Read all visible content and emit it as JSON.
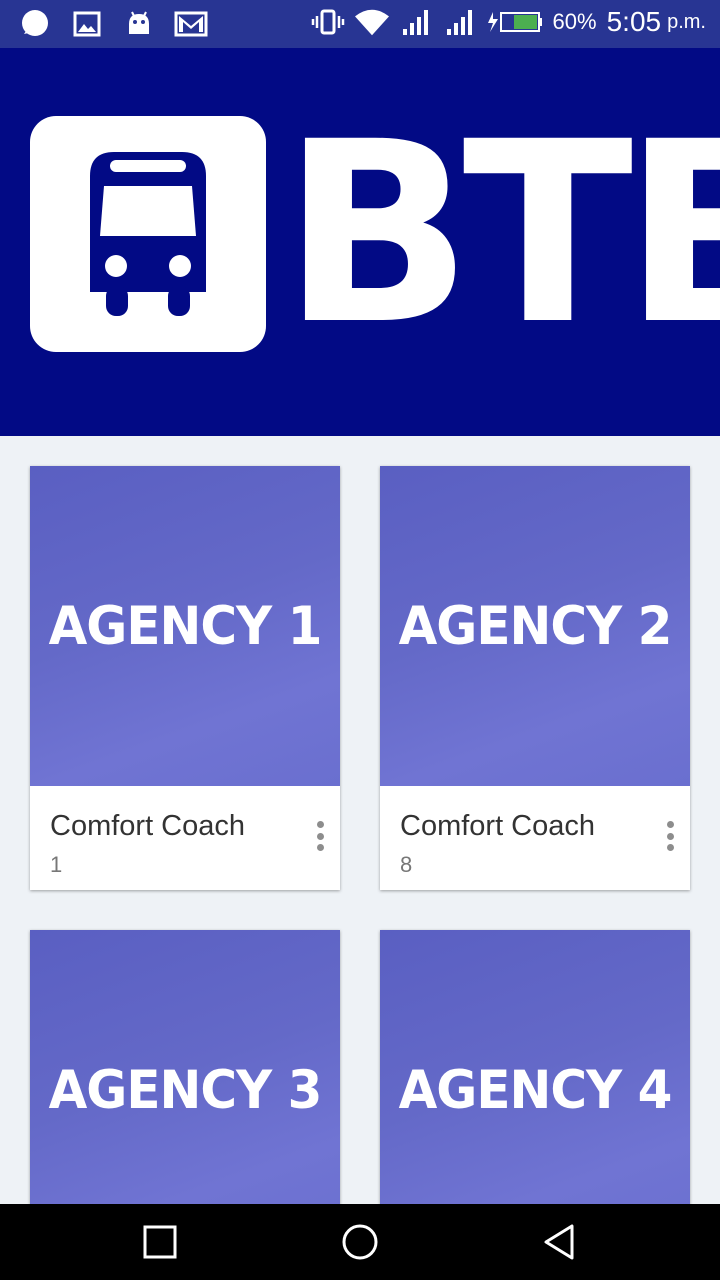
{
  "status_bar": {
    "icons_left": [
      "chat-icon",
      "image-icon",
      "android-icon",
      "gmail-icon"
    ],
    "icons_right": [
      "vibrate-icon",
      "wifi-icon",
      "signal-icon",
      "signal-icon",
      "battery-charging-icon"
    ],
    "battery": "60%",
    "time": "5:05",
    "ampm": "p.m."
  },
  "banner": {
    "logo_icon": "bus-icon",
    "brand": "BTB",
    "color": "#020a85"
  },
  "agencies": [
    {
      "image_label": "AGENCY 1",
      "title": "Comfort Coach",
      "subtitle": "1"
    },
    {
      "image_label": "AGENCY 2",
      "title": "Comfort Coach",
      "subtitle": "8"
    },
    {
      "image_label": "AGENCY 3",
      "title": "",
      "subtitle": ""
    },
    {
      "image_label": "AGENCY 4",
      "title": "",
      "subtitle": ""
    }
  ],
  "nav": [
    "recents-icon",
    "home-icon",
    "back-icon"
  ]
}
